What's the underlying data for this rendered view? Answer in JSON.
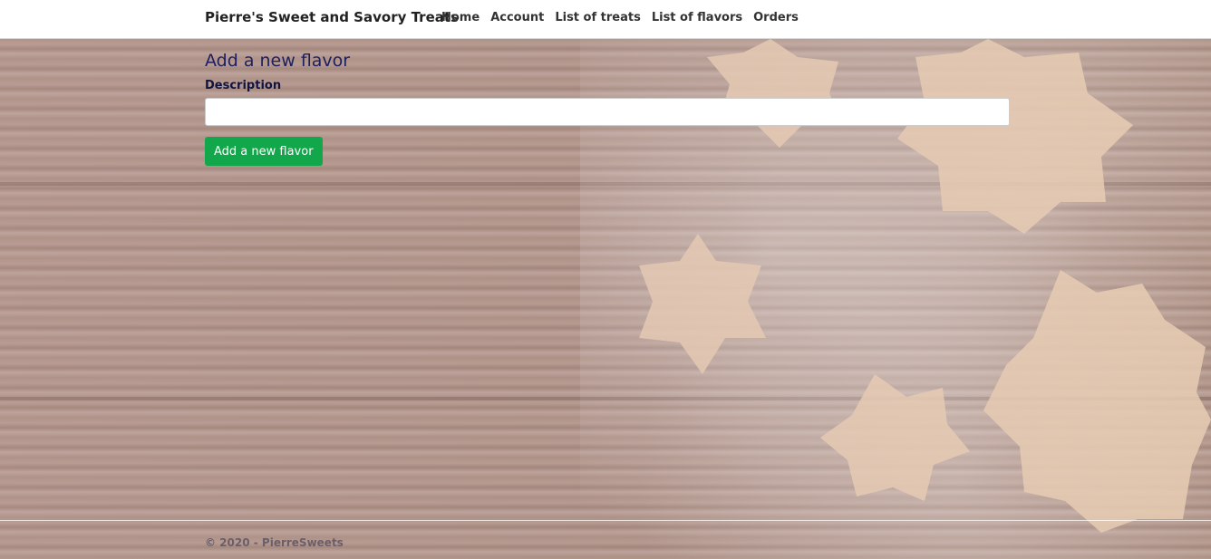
{
  "navbar": {
    "brand": "Pierre's Sweet and Savory Treats",
    "links": [
      "Home",
      "Account",
      "List of treats",
      "List of flavors",
      "Orders"
    ]
  },
  "main": {
    "title": "Add a new flavor",
    "description_label": "Description",
    "description_value": "",
    "submit_label": "Add a new flavor"
  },
  "footer": {
    "text": "© 2020 - PierreSweets"
  },
  "colors": {
    "button": "#11a74a",
    "title": "#1d1f5e"
  }
}
